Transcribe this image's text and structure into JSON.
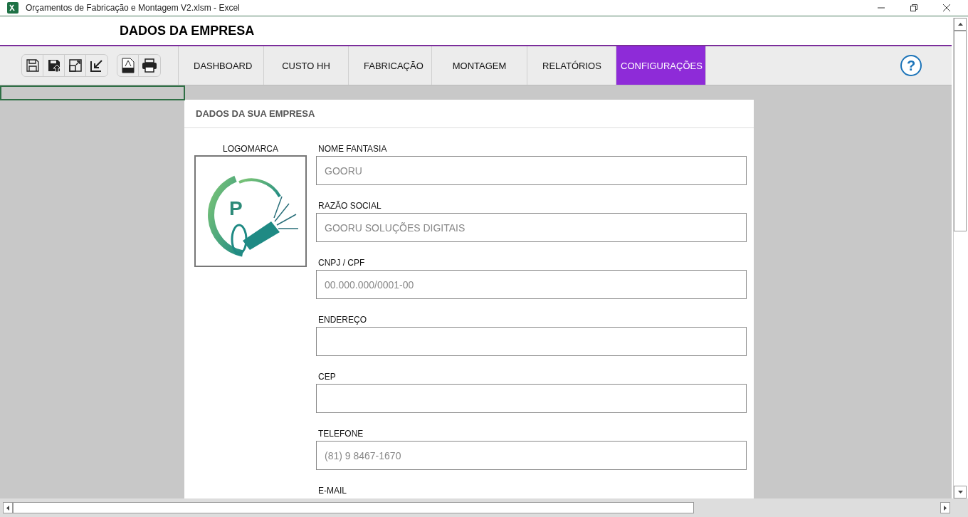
{
  "window": {
    "title": "Orçamentos de Fabricação e Montagem V2.xlsm - Excel"
  },
  "sheet_title": "DADOS DA EMPRESA",
  "tabs": [
    {
      "label": "DASHBOARD",
      "selected": false
    },
    {
      "label": "CUSTO HH",
      "selected": false
    },
    {
      "label": "FABRICAÇÃO",
      "selected": false
    },
    {
      "label": "MONTAGEM",
      "selected": false
    },
    {
      "label": "RELATÓRIOS",
      "selected": false
    },
    {
      "label": "CONFIGURAÇÕES",
      "selected": true
    }
  ],
  "help_button": {
    "label": "?"
  },
  "section": {
    "title": "DADOS DA SUA EMPRESA"
  },
  "logo": {
    "label": "LOGOMARCA",
    "letter": "P"
  },
  "fields": [
    {
      "label": "NOME FANTASIA",
      "value": "GOORU"
    },
    {
      "label": "RAZÃO SOCIAL",
      "value": "GOORU SOLUÇÕES DIGITAIS"
    },
    {
      "label": "CNPJ / CPF",
      "value": "00.000.000/0001-00"
    },
    {
      "label": "ENDEREÇO"
    },
    {
      "label": "CEP"
    },
    {
      "label": "TELEFONE",
      "value": "(81) 9 8467-1670"
    },
    {
      "label": "E-MAIL",
      "hidden_field": true
    }
  ]
}
